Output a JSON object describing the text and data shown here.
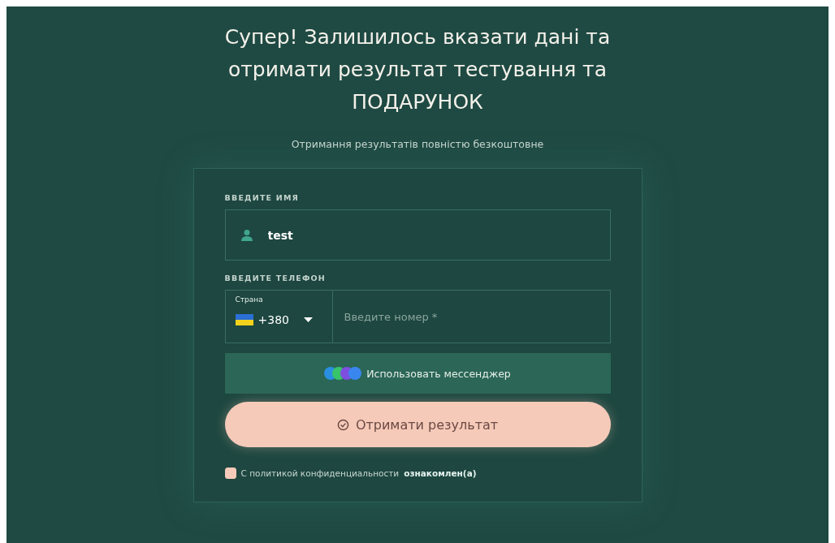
{
  "heading": "Супер! Залишилось вказати дані та отримати результат тестування та ПОДАРУНОК",
  "subheading": "Отримання результатів повністю безкоштовне",
  "form": {
    "name_label": "ВВЕДИТЕ ИМЯ",
    "name_value": "test",
    "phone_label": "ВВЕДИТЕ ТЕЛЕФОН",
    "country_label": "Страна",
    "country_code": "+380",
    "phone_placeholder": "Введите номер *",
    "messenger_button": "Использовать мессенджер",
    "submit_button": "Отримати результат",
    "consent": {
      "checked": true,
      "text": "С политикой конфиденциальности",
      "link": "ознакомлен(а)"
    }
  }
}
